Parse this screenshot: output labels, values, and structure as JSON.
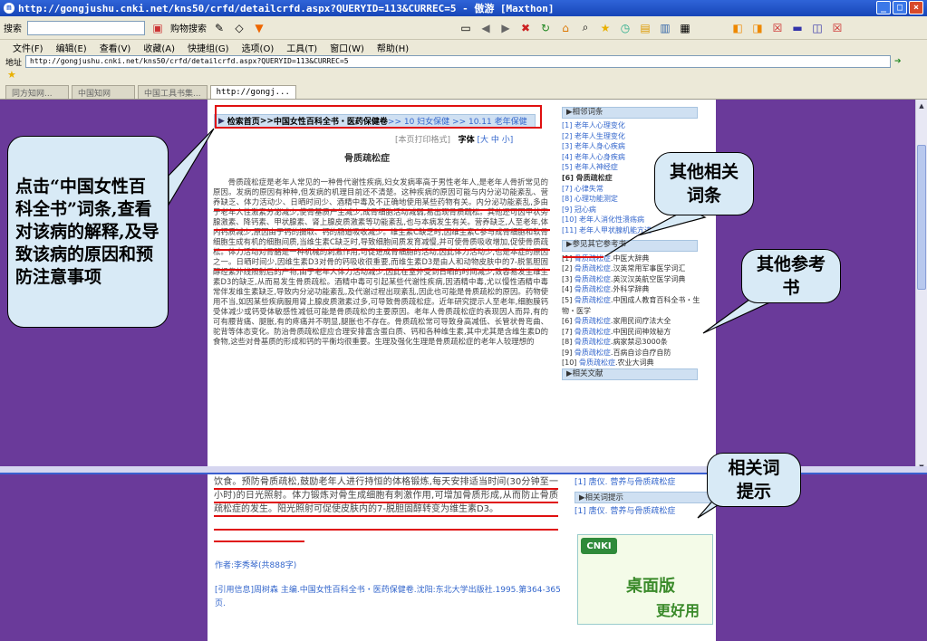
{
  "window": {
    "title": "http://gongjushu.cnki.net/kns50/crfd/detailcrfd.aspx?QUERYID=113&CURREC=5 - 傲游 [Maxthon]"
  },
  "toolbar": {
    "search_label": "搜索",
    "shopping_label": "购物搜索"
  },
  "menu": [
    "文件(F)",
    "编辑(E)",
    "查看(V)",
    "收藏(A)",
    "快捷组(G)",
    "选项(O)",
    "工具(T)",
    "窗口(W)",
    "帮助(H)"
  ],
  "address": {
    "label": "地址",
    "url": "http://gongjushu.cnki.net/kns50/crfd/detailcrfd.aspx?QUERYID=113&CURREC=5"
  },
  "tabs": [
    "同方知网...",
    "中国知网",
    "中国工具书集...",
    "http://gongj..."
  ],
  "breadcrumb": {
    "home": "检索首页",
    "sep1": " >> ",
    "book": "中国女性百科全书・医药保健卷",
    "rest": " >> 10 妇女保健 >> 10.11 老年保健"
  },
  "print": {
    "label": "[本页打印格式]",
    "font_label": "字体",
    "sizes": "[大 中 小]"
  },
  "article": {
    "title": "骨质疏松症",
    "body": "骨质疏松症是老年人常见的一种骨代谢性疾病,妇女发病率高于男性老年人,是老年人骨折常见的原因。发病的原因有种种,但发病的机理目前还不清楚。这种疾病的原因可能与内分泌功能紊乱、营养缺乏、体力活动少、日晒时间少、酒精中毒及不正确地使用某些药物有关。内分泌功能紊乱,多由于老年人性激素分泌减少,使骨基质产生减少,成骨细胞活动减弱,易出现骨质疏松。其他还可因甲状旁腺激素、降钙素、甲状腺素、肾上腺皮质激素等功能紊乱,也与本病发生有关。营养缺乏,人至老年,体内钙质减少,原因由于钙的摄取、钙的肠道吸收减少。维生素C缺乏时,因维生素C参与成骨细胞和软骨细胞生成有机的细胞间质,当维生素C缺乏时,导致细胞间质发育减慢,并可使骨质吸收增加,促使骨质疏松。体力活动对骨骼是一种机械的刺激作用,可促进成骨细胞的活动,因此体力活动少,也是本症的原因之一。日晒时间少,因维生素D3对骨的钙吸收很重要,而维生素D3是由人和动物皮肤中的7-脱氢胆固醇经紫外线照射后的产物,由于老年人体力活动减少,因此在室外受到日晒的时间减少,致容易发生维生素D3的缺乏,从而易发生骨质疏松。酒精中毒可引起某些代谢性疾病,因酒精中毒,尤以慢性酒精中毒常伴发维生素缺乏,导致内分泌功能紊乱,及代谢过程出现紊乱,因此也可能是骨质疏松的原因。药物使用不当,如因某些疾病服用肾上腺皮质激素过多,可导致骨质疏松症。近年研究提示人至老年,细胞膜钙受体减少或钙受体敏感性减低可能是骨质疏松的主要原因。老年人骨质疏松症的表现因人而异,有的可有腰背痛、腿胀,有的疼痛并不明显,腿胀也不存在。骨质疏松常可导致身高减低、长管状骨弯曲、驼背等体态变化。防治骨质疏松症应合理安排富含蛋白质、钙和各种维生素,其中尤其是含维生素D的食物,这些对骨基质的形成和钙的平衡均很重要。生理及强化生理是骨质疏松症的老年人较理想的",
    "lower": "饮食。预防骨质疏松,鼓励老年人进行持恒的体格锻炼,每天安排适当时间(30分钟至一小时)的日光照射。体力锻炼对骨生成细胞有刺激作用,可增加骨质形成,从而防止骨质疏松症的发生。阳光照射可促使皮肤内的7-脱胆固醇转变为维生素D3。",
    "author": "作者:李秀琴(共888字)",
    "citation": "[引用信息]周树森 主编.中国女性百科全书・医药保健卷.沈阳:东北大学出版社.1995.第364-365页."
  },
  "sidebar": {
    "related_head": "相邻词条",
    "related": [
      "[1] 老年人心理变化",
      "[2] 老年人生理变化",
      "[3] 老年人身心疾病",
      "[4] 老年人心身疾病",
      "[5] 老年人神经症",
      "[6] 骨质疏松症",
      "[7] 心律失常",
      "[8] 心理功能测定",
      "[9] 冠心病",
      "[10] 老年人消化性溃疡病",
      "[11] 老年人甲状腺机能亢进"
    ],
    "refs_head": "参见其它参考书",
    "refs": [
      {
        "n": "[1]",
        "a": "骨质疏松症",
        "b": "中医大辞典"
      },
      {
        "n": "[2]",
        "a": "骨质疏松症",
        "b": "汉英常用军事医学词汇"
      },
      {
        "n": "[3]",
        "a": "骨质疏松症",
        "b": "英汉汉英航空医学词典"
      },
      {
        "n": "[4]",
        "a": "骨质疏松症",
        "b": "外科学辞典"
      },
      {
        "n": "[5]",
        "a": "骨质疏松症",
        "b": "中国成人教育百科全书・生物・医学"
      },
      {
        "n": "[6]",
        "a": "骨质疏松症",
        "b": "家用民间疗法大全"
      },
      {
        "n": "[7]",
        "a": "骨质疏松症",
        "b": "中国民间神效秘方"
      },
      {
        "n": "[8]",
        "a": "骨质疏松症",
        "b": "病家禁忌3000条"
      },
      {
        "n": "[9]",
        "a": "骨质疏松症",
        "b": "百病自诊自疗自防"
      },
      {
        "n": "[10]",
        "a": "骨质疏松症",
        "b": "农业大词典"
      }
    ],
    "cut_head": "相关文献",
    "docs": [
      "[1] 唐仪. 营养与骨质疏松症"
    ],
    "hint_head": "相关词提示",
    "hints": [
      "[1] 唐仪. 营养与骨质疏松症"
    ]
  },
  "ad": {
    "logo": "CNKI",
    "line1": "桌面版",
    "line2": "更好用"
  },
  "callouts": {
    "left": "点击“中国女性百科全书”词条,查看对该病的解释,及导致该病的原因和预防注意事项",
    "related": "其他相关词条",
    "refs": "其他参考书",
    "hint": "相关词提示"
  },
  "colors": {
    "background": "#6a3a9a",
    "highlight": "#e01010",
    "link": "#3366cc",
    "callout": "#d8eaf6"
  }
}
